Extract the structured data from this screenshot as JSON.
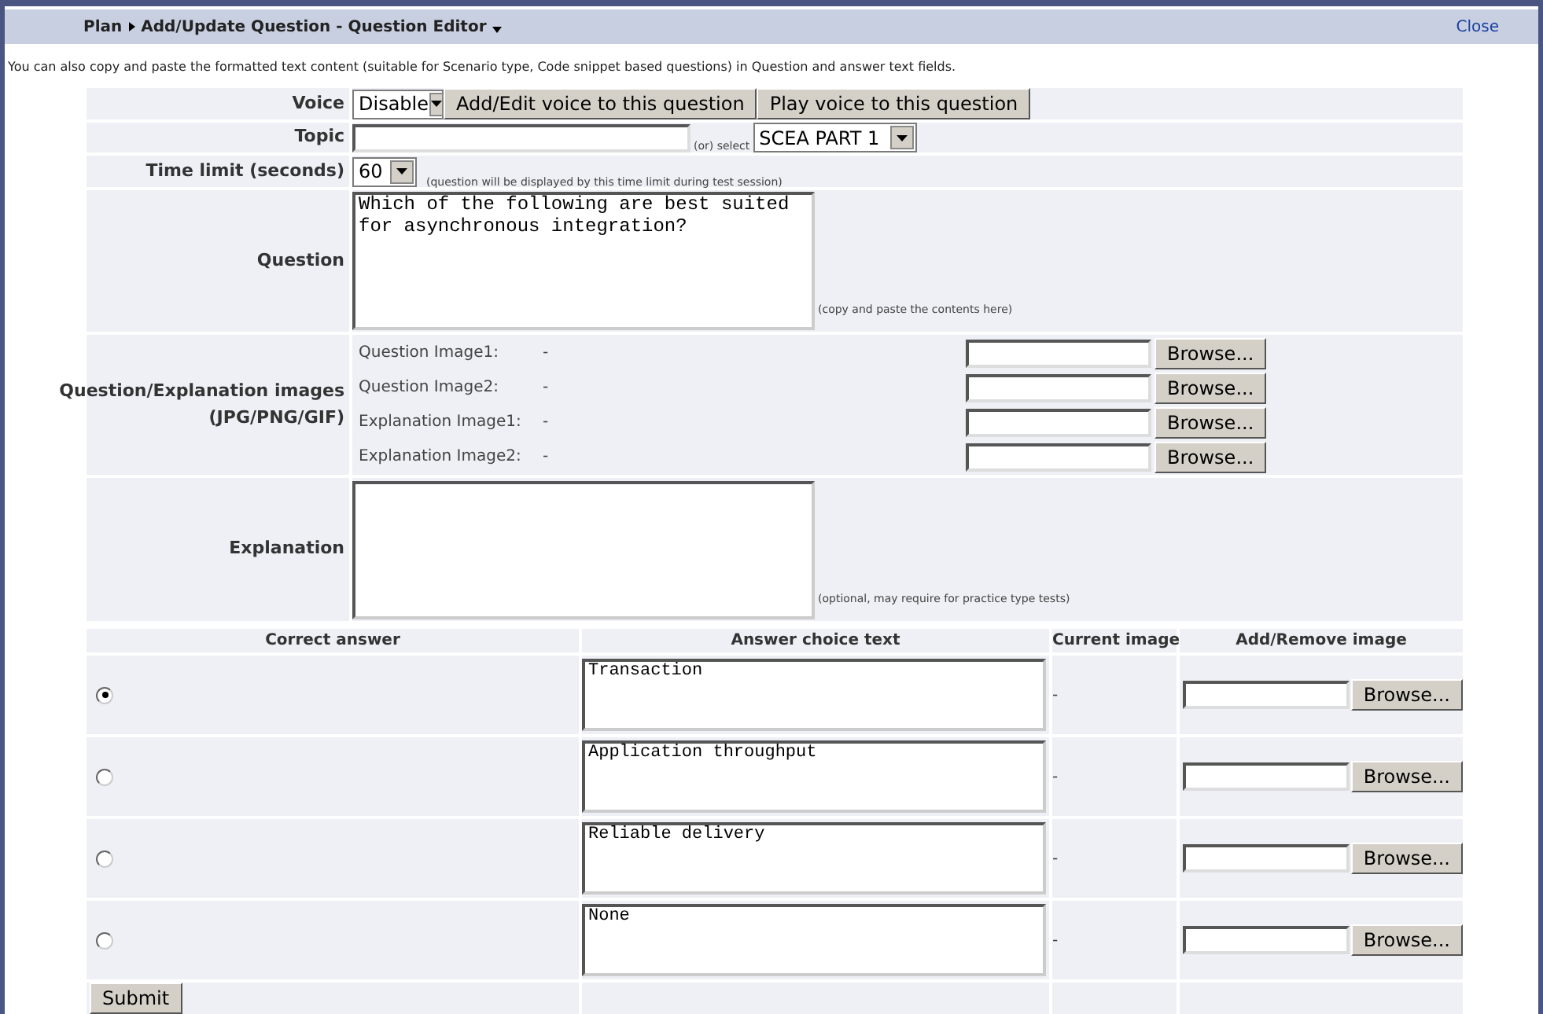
{
  "header": {
    "breadcrumb": [
      "Plan",
      "Add/Update Question - Question Editor"
    ],
    "close": "Close"
  },
  "intro": "You can also copy and paste the formatted text content (suitable for Scenario type, Code snippet based questions) in Question and answer text fields.",
  "voice": {
    "label": "Voice",
    "value": "Disable",
    "buttons": [
      "Add/Edit voice to this question",
      "Play voice to this question"
    ]
  },
  "topic": {
    "label": "Topic",
    "or_select": "(or) select",
    "select_value": "SCEA PART 1"
  },
  "time_limit": {
    "label": "Time limit (seconds)",
    "value": "60",
    "hint": "(question will be displayed by this time limit during test session)"
  },
  "question": {
    "label": "Question",
    "value": "Which of the following are best suited for asynchronous integration?",
    "hint": "(copy and paste the contents here)"
  },
  "images": {
    "label": "Question/Explanation images",
    "sublabel": "(JPG/PNG/GIF)",
    "items": [
      {
        "label": "Question Image1:",
        "value": "-",
        "button": "Browse..."
      },
      {
        "label": "Question Image2:",
        "value": "-",
        "button": "Browse..."
      },
      {
        "label": "Explanation Image1:",
        "value": "-",
        "button": "Browse..."
      },
      {
        "label": "Explanation Image2:",
        "value": "-",
        "button": "Browse..."
      }
    ]
  },
  "explanation": {
    "label": "Explanation",
    "hint": "(optional, may require for practice type tests)"
  },
  "answers": {
    "columns": [
      "Correct answer",
      "Answer choice text",
      "Current image",
      "Add/Remove image"
    ],
    "rows": [
      {
        "selected": true,
        "text": "Transaction",
        "image": "-",
        "button": "Browse..."
      },
      {
        "selected": false,
        "text": "Application throughput",
        "image": "-",
        "button": "Browse..."
      },
      {
        "selected": false,
        "text": "Reliable delivery",
        "image": "-",
        "button": "Browse..."
      },
      {
        "selected": false,
        "text": "None",
        "image": "-",
        "button": "Browse..."
      }
    ]
  },
  "submit": "Submit"
}
